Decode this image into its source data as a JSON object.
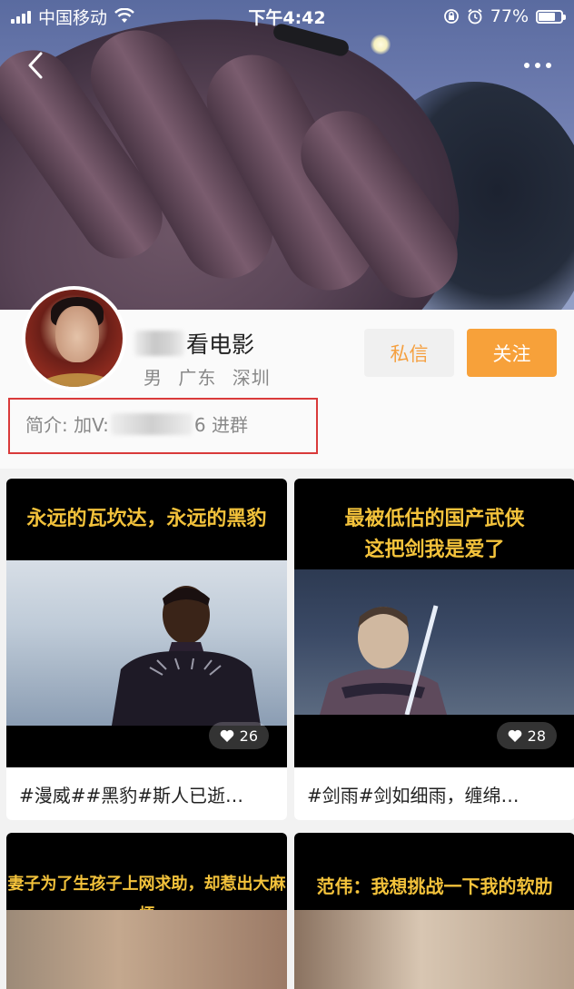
{
  "status_bar": {
    "carrier": "中国移动",
    "time": "下午4:42",
    "battery": "77%",
    "battery_level": 0.77
  },
  "profile": {
    "name_suffix": "看电影",
    "gender": "男",
    "province": "广东",
    "city": "深圳",
    "message_label": "私信",
    "follow_label": "关注",
    "intro_prefix": "简介: 加V: ",
    "intro_suffix": "6 进群"
  },
  "videos": [
    {
      "caption": "永远的瓦坎达，永远的黑豹",
      "likes": "26",
      "title": "#漫威##黑豹#斯人已逝…"
    },
    {
      "caption_line1": "最被低估的国产武侠",
      "caption_line2": "这把剑我是爱了",
      "likes": "28",
      "title": "#剑雨#剑如细雨，缠绵…"
    },
    {
      "caption": "妻子为了生孩子上网求助，却惹出大麻烦"
    },
    {
      "caption": "范伟：我想挑战一下我的软肋"
    }
  ],
  "colors": {
    "accent": "#f7a13a",
    "highlight_border": "#d93a3a",
    "caption_yellow": "#f3c23b"
  },
  "icons": [
    "back-chevron-icon",
    "more-dots-icon",
    "heart-icon",
    "wifi-icon",
    "alarm-icon",
    "rotation-lock-icon"
  ]
}
